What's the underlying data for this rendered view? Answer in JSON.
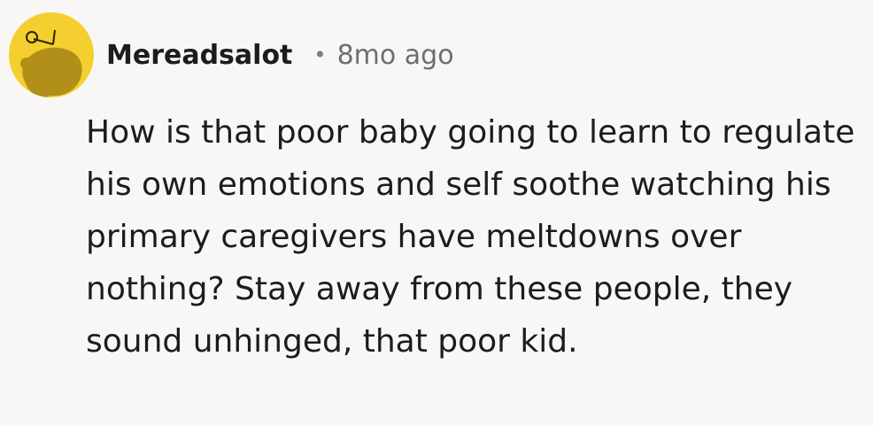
{
  "comment": {
    "avatar_icon": "snoo-avatar-icon",
    "avatar_color": "#f5cf30",
    "author": "Mereadsalot",
    "separator": "•",
    "timestamp": "8mo ago",
    "text": "How is that poor baby going to learn to regulate his own emotions and self soothe watching his primary caregivers have meltdowns over nothing? Stay away from these people, they sound unhinged, that poor kid."
  }
}
